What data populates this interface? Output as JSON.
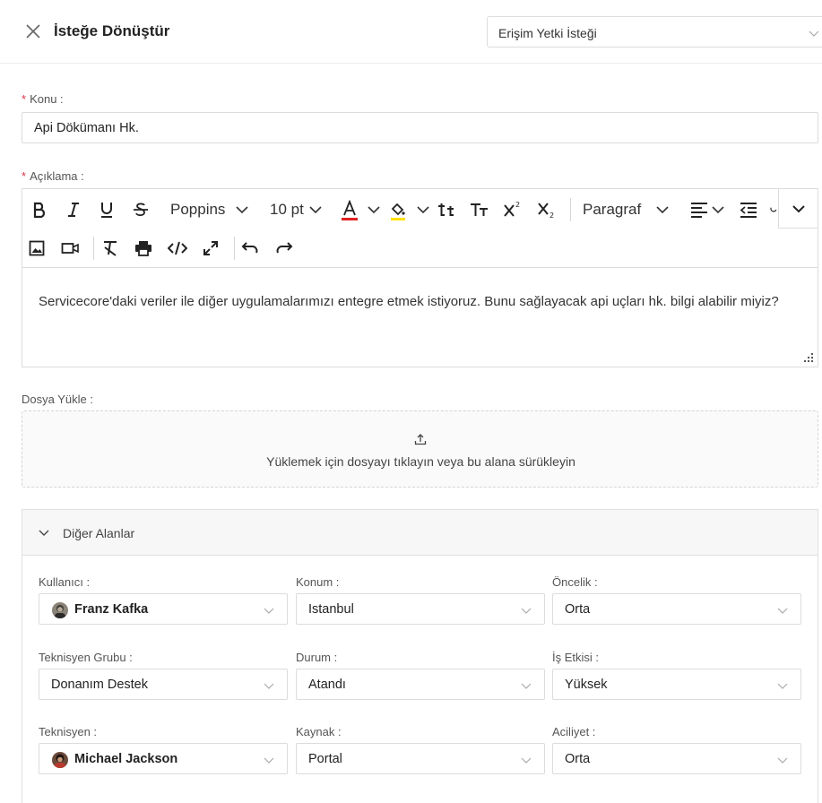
{
  "header": {
    "title": "İsteğe Dönüştür",
    "request_type": "Erişim Yetki İsteği"
  },
  "subject": {
    "label": "Konu :",
    "value": "Api Dökümanı Hk."
  },
  "description": {
    "label": "Açıklama :",
    "toolbar": {
      "font_family": "Poppins",
      "font_size": "10 pt",
      "paragraph": "Paragraf",
      "font_color": "#e02020",
      "highlight_color": "#ffe000"
    },
    "content": "Servicecore'daki veriler ile diğer uygulamalarımızı entegre etmek istiyoruz. Bunu sağlayacak api uçları hk. bilgi alabilir miyiz?"
  },
  "upload": {
    "label": "Dosya Yükle :",
    "hint": "Yüklemek için dosyayı tıklayın veya bu alana sürükleyin"
  },
  "other_fields": {
    "title": "Diğer Alanlar",
    "fields": [
      {
        "label": "Kullanıcı :",
        "value": "Franz Kafka"
      },
      {
        "label": "Konum :",
        "value": "Istanbul"
      },
      {
        "label": "Öncelik :",
        "value": "Orta"
      },
      {
        "label": "Teknisyen Grubu :",
        "value": "Donanım Destek"
      },
      {
        "label": "Durum :",
        "value": "Atandı"
      },
      {
        "label": "İş Etkisi :",
        "value": "Yüksek"
      },
      {
        "label": "Teknisyen :",
        "value": "Michael Jackson"
      },
      {
        "label": "Kaynak :",
        "value": "Portal"
      },
      {
        "label": "Aciliyet :",
        "value": "Orta"
      }
    ]
  },
  "colors": {
    "required_marker": "#e0334a",
    "border": "#dcdcdc"
  }
}
